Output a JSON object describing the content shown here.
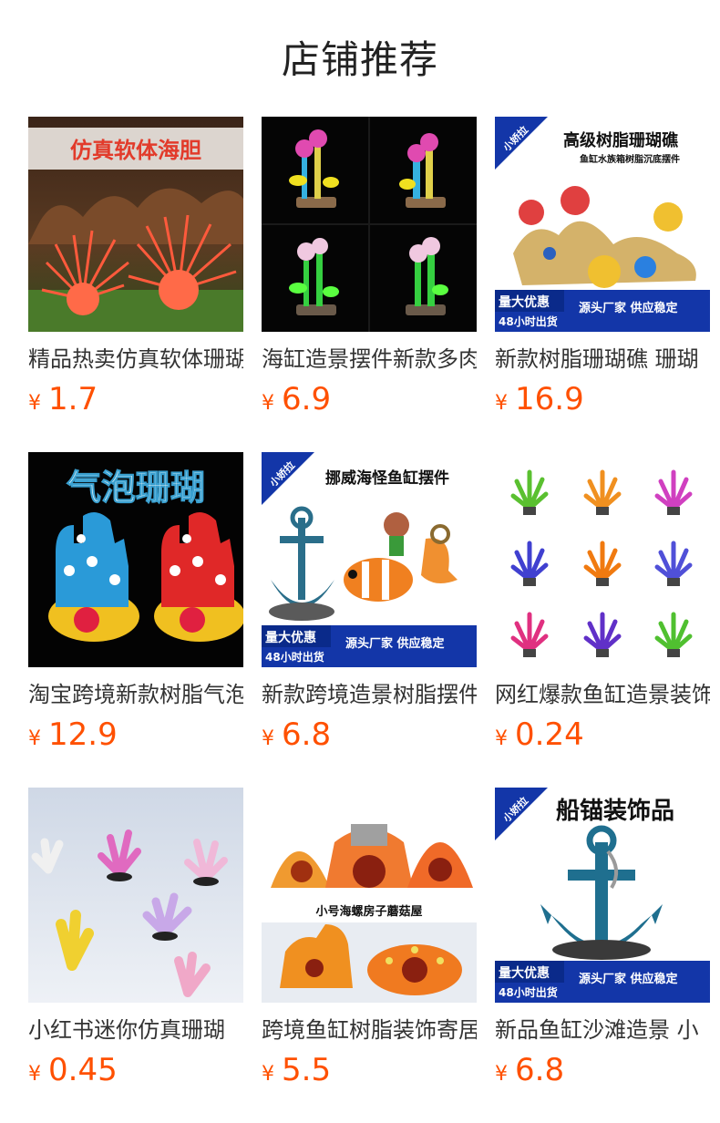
{
  "header": {
    "title": "店铺推荐"
  },
  "products": [
    {
      "name": "精品热卖仿真软体珊瑚",
      "currency": "¥",
      "price": "1.7",
      "image_text": "仿真软体海胆"
    },
    {
      "name": "海缸造景摆件新款多肉",
      "currency": "¥",
      "price": "6.9"
    },
    {
      "name": "新款树脂珊瑚礁 珊瑚",
      "currency": "¥",
      "price": "16.9",
      "image_brand": "小娇拉",
      "image_title": "高级树脂珊瑚礁",
      "image_subtitle": "鱼缸水族箱树脂沉底摆件",
      "image_promo_1": "量大优惠",
      "image_promo_2": "48小时出货",
      "image_promo_3": "源头厂家 供应稳定"
    },
    {
      "name": "淘宝跨境新款树脂气泡",
      "currency": "¥",
      "price": "12.9",
      "image_text": "气泡珊瑚"
    },
    {
      "name": "新款跨境造景树脂摆件",
      "currency": "¥",
      "price": "6.8",
      "image_brand": "小娇拉",
      "image_title": "挪威海怪鱼缸摆件",
      "image_promo_1": "量大优惠",
      "image_promo_2": "48小时出货",
      "image_promo_3": "源头厂家 供应稳定"
    },
    {
      "name": "网红爆款鱼缸造景装饰",
      "currency": "¥",
      "price": "0.24"
    },
    {
      "name": "小红书迷你仿真珊瑚",
      "currency": "¥",
      "price": "0.45"
    },
    {
      "name": "跨境鱼缸树脂装饰寄居",
      "currency": "¥",
      "price": "5.5",
      "image_text": "小号海螺房子蘑菇屋"
    },
    {
      "name": "新品鱼缸沙滩造景 小",
      "currency": "¥",
      "price": "6.8",
      "image_brand": "小娇拉",
      "image_title": "船锚装饰品",
      "image_promo_1": "量大优惠",
      "image_promo_2": "48小时出货",
      "image_promo_3": "源头厂家 供应稳定"
    }
  ],
  "colors": {
    "price": "#ff5000",
    "title": "#222222",
    "name": "#333333",
    "promo_blue": "#1336a8"
  }
}
